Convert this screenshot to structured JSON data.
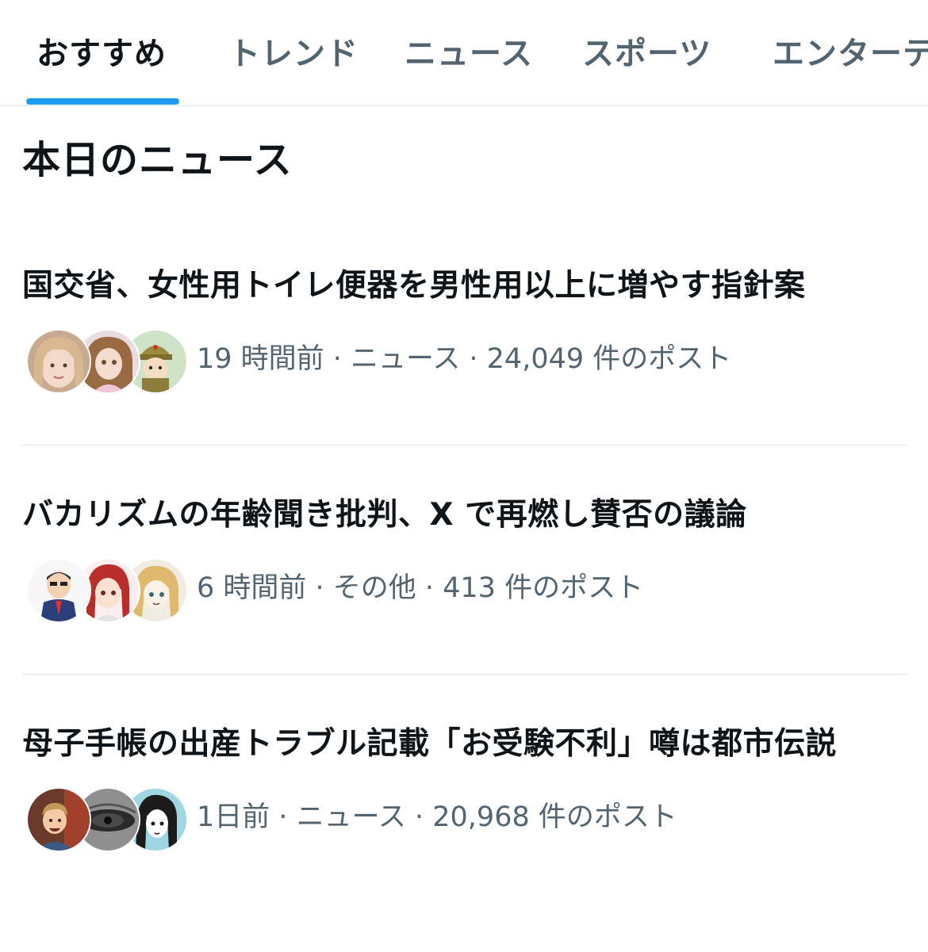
{
  "tabs": [
    {
      "label": "おすすめ",
      "active": true
    },
    {
      "label": "トレンド",
      "active": false
    },
    {
      "label": "ニュース",
      "active": false
    },
    {
      "label": "スポーツ",
      "active": false
    },
    {
      "label": "エンターテ",
      "active": false
    }
  ],
  "section": {
    "title": "本日のニュース"
  },
  "news": [
    {
      "headline": "国交省、女性用トイレ便器を男性用以上に増やす指針案",
      "meta": "19 時間前 · ニュース · 24,049 件のポスト",
      "avatars": [
        "avatar-blonde-woman",
        "avatar-doll",
        "avatar-soldier-character"
      ]
    },
    {
      "headline": "バカリズムの年齢聞き批判、X で再燃し賛否の議論",
      "meta": "6 時間前 · その他 · 413 件のポスト",
      "avatars": [
        "avatar-businessman-cartoon",
        "avatar-red-hair-anime",
        "avatar-anime-girl-sketch"
      ]
    },
    {
      "headline": "母子手帳の出産トラブル記載「お受験不利」噂は都市伝説",
      "meta": "1日前 · ニュース · 20,968 件のポスト",
      "avatars": [
        "avatar-child-photo",
        "avatar-dark-eye",
        "avatar-manga-girl"
      ]
    }
  ],
  "colors": {
    "accent": "#1d9bf0",
    "text_primary": "#0f1419",
    "text_secondary": "#536471",
    "divider": "#e1e4e8"
  }
}
